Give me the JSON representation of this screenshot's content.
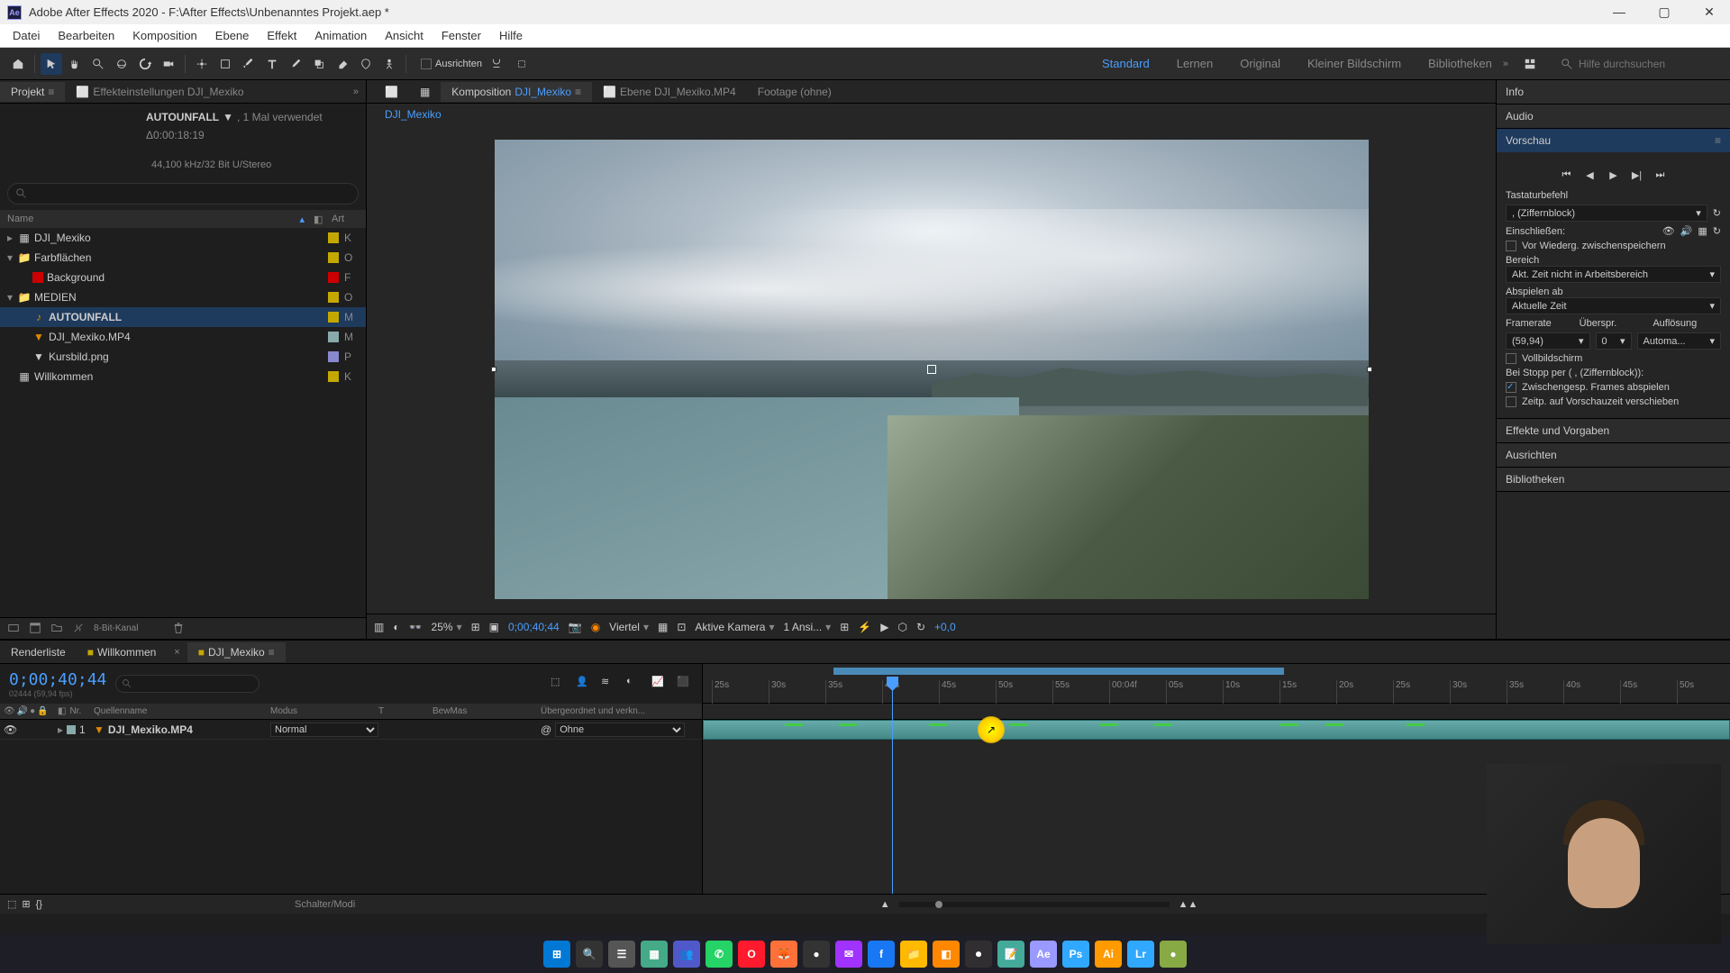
{
  "titlebar": {
    "app_logo": "Ae",
    "title": "Adobe After Effects 2020 - F:\\After Effects\\Unbenanntes Projekt.aep *"
  },
  "menu": [
    "Datei",
    "Bearbeiten",
    "Komposition",
    "Ebene",
    "Effekt",
    "Animation",
    "Ansicht",
    "Fenster",
    "Hilfe"
  ],
  "toolbar": {
    "align_label": "Ausrichten",
    "workspaces": [
      "Standard",
      "Lernen",
      "Original",
      "Kleiner Bildschirm",
      "Bibliotheken"
    ],
    "active_workspace": "Standard",
    "search_placeholder": "Hilfe durchsuchen"
  },
  "project": {
    "tab_label": "Projekt",
    "effects_tab": "Effekteinstellungen DJI_Mexiko",
    "selected_asset": "AUTOUNFALL",
    "asset_dropdown_suffix": "▼",
    "asset_usage": ", 1 Mal verwendet",
    "asset_duration": "Δ0:00:18:19",
    "audio_meta": "44,100 kHz/32 Bit U/Stereo",
    "col_name": "Name",
    "col_art": "Art",
    "tree": [
      {
        "indent": 0,
        "arrow": "▸",
        "icon": "comp",
        "name": "DJI_Mexiko",
        "chip": "#c4a800",
        "type": "K"
      },
      {
        "indent": 0,
        "arrow": "▾",
        "icon": "folder",
        "name": "Farbflächen",
        "chip": "#c4a800",
        "type": "O"
      },
      {
        "indent": 1,
        "arrow": "",
        "icon": "solid",
        "chip_left": "#c00",
        "name": "Background",
        "chip": "#c00",
        "type": "F"
      },
      {
        "indent": 0,
        "arrow": "▾",
        "icon": "folder",
        "name": "MEDIEN",
        "chip": "#c4a800",
        "type": "O"
      },
      {
        "indent": 1,
        "arrow": "",
        "icon": "audio",
        "name": "AUTOUNFALL",
        "selected": true,
        "chip": "#c4a800",
        "type": "M"
      },
      {
        "indent": 1,
        "arrow": "",
        "icon": "video",
        "name": "DJI_Mexiko.MP4",
        "chip": "#8aa",
        "type": "M"
      },
      {
        "indent": 1,
        "arrow": "",
        "icon": "image",
        "name": "Kursbild.png",
        "chip": "#88c",
        "type": "P"
      },
      {
        "indent": 0,
        "arrow": "",
        "icon": "comp",
        "name": "Willkommen",
        "chip": "#c4a800",
        "type": "K"
      }
    ],
    "bit_depth": "8-Bit-Kanal"
  },
  "composition": {
    "comp_tab": "Komposition",
    "comp_name": "DJI_Mexiko",
    "layer_tab": "Ebene DJI_Mexiko.MP4",
    "footage_tab": "Footage (ohne)",
    "breadcrumb": "DJI_Mexiko",
    "footer": {
      "zoom": "25%",
      "time": "0;00;40;44",
      "resolution": "Viertel",
      "camera": "Aktive Kamera",
      "view_count": "1 Ansi...",
      "exposure": "+0,0"
    }
  },
  "right": {
    "sections": {
      "info": "Info",
      "audio": "Audio",
      "vorschau": "Vorschau",
      "effekte": "Effekte und Vorgaben",
      "ausrichten": "Ausrichten",
      "bibliotheken": "Bibliotheken"
    },
    "vorschau": {
      "keyboard_label": "Tastaturbefehl",
      "keyboard_value": ", (Ziffernblock)",
      "include_label": "Einschließen:",
      "cache_label": "Vor Wiederg. zwischenspeichern",
      "bereich_label": "Bereich",
      "bereich_value": "Akt. Zeit nicht in Arbeitsbereich",
      "abspielen_label": "Abspielen ab",
      "abspielen_value": "Aktuelle Zeit",
      "framerate_label": "Framerate",
      "skip_label": "Überspr.",
      "resolution_label": "Auflösung",
      "framerate_value": "(59,94)",
      "skip_value": "0",
      "resolution_value": "Automa...",
      "fullscreen_label": "Vollbildschirm",
      "stop_label": "Bei Stopp per ( , (Ziffernblock)):",
      "cached_frames_label": "Zwischengesp. Frames abspielen",
      "move_time_label": "Zeitp. auf Vorschauzeit verschieben"
    }
  },
  "timeline": {
    "tabs": {
      "render": "Renderliste",
      "willkommen": "Willkommen",
      "comp": "DJI_Mexiko"
    },
    "timecode": "0;00;40;44",
    "timecode_sub": "02444 (59,94 fps)",
    "cols": {
      "nr": "Nr.",
      "source": "Quellenname",
      "mode": "Modus",
      "trk": "T",
      "bew": "BewMas",
      "parent": "Übergeordnet und verkn..."
    },
    "layer": {
      "num": "1",
      "name": "DJI_Mexiko.MP4",
      "mode": "Normal",
      "parent": "Ohne"
    },
    "ruler_ticks": [
      "25s",
      "30s",
      "35s",
      "40s",
      "45s",
      "50s",
      "55s",
      "00:04f",
      "05s",
      "10s",
      "15s",
      "20s",
      "25s",
      "30s",
      "35s",
      "40s",
      "45s",
      "50s"
    ],
    "switch_label": "Schalter/Modi"
  },
  "taskbar": {
    "icons": [
      "windows",
      "search",
      "tasks",
      "widgets",
      "teams",
      "whatsapp",
      "opera",
      "firefox",
      "app1",
      "messenger",
      "facebook",
      "explorer",
      "app2",
      "obs",
      "notepad",
      "ae",
      "ps",
      "ai",
      "lr",
      "app3"
    ]
  }
}
